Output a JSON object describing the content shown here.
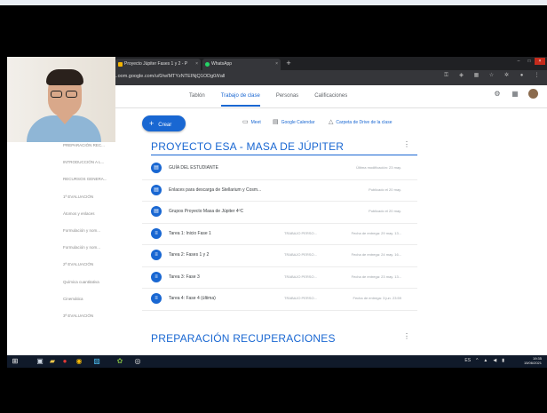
{
  "browser": {
    "tabs": [
      {
        "label": "Proyecto Júpiter Fases 1 y 2 - P",
        "icon": "classroom-tab-icon"
      },
      {
        "label": "WhatsApp",
        "icon": "whatsapp-tab-icon"
      }
    ],
    "url": "...oom.google.com/u/0/w/MTYzNTEINjQ1ODg0/t/all"
  },
  "classroom": {
    "nav_tabs": [
      "Tablón",
      "Trabajo de clase",
      "Personas",
      "Calificaciones"
    ],
    "active_tab": "Trabajo de clase",
    "create_label": "Crear",
    "actions": {
      "meet": "Meet",
      "calendar": "Google Calendar",
      "drive": "Carpeta de Drive de la clase"
    },
    "sidebar": [
      "Todos los temas",
      "PROYECTO ESA - M...",
      "PREPARACIÓN REC...",
      "INTRODUCCIÓN A L...",
      "RECURSOS GENERA...",
      "1ª EVALUACIÓN",
      "Átomos y enlaces",
      "Formulación y nom...",
      "Formulación y nom...",
      "2ª EVALUACIÓN",
      "Química cuantitativa",
      "Cinemática",
      "3ª EVALUACIÓN"
    ],
    "topic1": {
      "title": "PROYECTO ESA - MASA DE JÚPITER",
      "items": [
        {
          "type": "material",
          "title": "GUÍA DEL ESTUDIANTE",
          "mid": "",
          "right": "Última modificación: 23 may."
        },
        {
          "type": "material",
          "title": "Enlaces para descarga de Stellarium y Cosm...",
          "mid": "",
          "right": "Publicado el 20 may."
        },
        {
          "type": "material",
          "title": "Grupos Proyecto Masa de Júpiter 4ºC",
          "mid": "",
          "right": "Publicado el 20 may."
        },
        {
          "type": "assignment",
          "title": "Tarea 1: Inicio Fase 1",
          "mid": "TRABAJO PERSO...",
          "right": "Fecha de entrega: 29 may. 13..."
        },
        {
          "type": "assignment",
          "title": "Tarea 2: Fases 1 y 2",
          "mid": "TRABAJO PERSO...",
          "right": "Fecha de entrega: 24 may. 16..."
        },
        {
          "type": "assignment",
          "title": "Tarea 3: Fase 3",
          "mid": "TRABAJO PERSO...",
          "right": "Fecha de entrega: 23 may. 13..."
        },
        {
          "type": "assignment",
          "title": "Tarea 4: Fase 4 (última)",
          "mid": "TRABAJO PERSO...",
          "right": "Fecha de entrega: 3 jun. 23:59"
        }
      ]
    },
    "topic2": {
      "title": "PREPARACIÓN RECUPERACIONES"
    }
  },
  "taskbar": {
    "tray_lang": "ES",
    "time": "19:35",
    "date": "15/06/2021"
  },
  "colors": {
    "accent": "#1967d2",
    "taskbar": "#101a2a",
    "chrome_dark": "#202124"
  }
}
